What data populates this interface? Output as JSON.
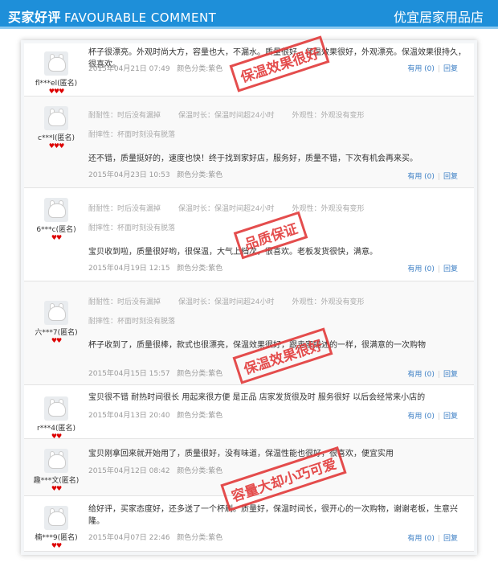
{
  "header": {
    "title_cn": "买家好评",
    "title_en": "FAVOURABLE COMMENT",
    "shop": "优宜居家用品店"
  },
  "ui": {
    "useful": "有用 (0)",
    "reply": "回复"
  },
  "stamps": [
    "保温效果很好",
    "品质保证",
    "保温效果很好",
    "容量大却小巧可爱"
  ],
  "reviews": [
    {
      "user": "fl***el(匿名)",
      "level": "♥♥♥",
      "text": "杯子很漂亮。外观时尚大方，容量也大，不漏水。质量很好，保温效果很好，外观漂亮。保温效果很持久，很喜欢。",
      "date": "2015年04月21日 07:49",
      "color": "颜色分类:紫色"
    },
    {
      "user": "c***l(匿名)",
      "level": "♥♥♥",
      "tags": [
        "耐耐性：时后没有漏掉",
        "保温时长：保温时间超24小时",
        "外观性：外观没有变形"
      ],
      "tag2": "耐摔性：杯面时刻没有脱落",
      "text": "还不错，质量挺好的，速度也快！终于找到家好店，服务好，质量不错，下次有机会再来买。",
      "date": "2015年04月23日 10:53",
      "color": "颜色分类:紫色"
    },
    {
      "user": "6***c(匿名)",
      "level": "♥♥",
      "tags": [
        "耐耐性：时后没有漏掉",
        "保温时长：保温时间超24小时",
        "外观性：外观没有变形"
      ],
      "tag2": "耐摔性：杯面时刻没有脱落",
      "text": "宝贝收到啦，质量很好哟，很保温，大气上档次，很喜欢。老板发货很快，满意。",
      "date": "2015年04月19日 12:15",
      "color": "颜色分类:紫色"
    },
    {
      "user": "六***7(匿名)",
      "level": "♥♥",
      "tags": [
        "耐耐性：时后没有漏掉",
        "保温时长：保温时间超24小时",
        "外观性：外观没有变形"
      ],
      "tag2": "耐摔性：杯面时刻没有脱落",
      "text": "杯子收到了，质量很棒，款式也很漂亮，保温效果很好，跟卖家描述的一样，很满意的一次购物",
      "date": "2015年04月15日 15:57",
      "color": "颜色分类:紫色"
    },
    {
      "user": "r***4(匿名)",
      "level": "♥♥",
      "text": "宝贝很不错 耐热时间很长 用起来很方便 是正品 店家发货很及时 服务很好 以后会经常来小店的",
      "date": "2015年04月13日 20:40",
      "color": "颜色分类:紫色"
    },
    {
      "user": "趣***文(匿名)",
      "level": "♥♥",
      "text": "宝贝刚拿回来就开始用了，质量很好，没有味道，保温性能也很好，很喜欢，便宜实用",
      "date": "2015年04月12日 08:42",
      "color": "颜色分类:紫色"
    },
    {
      "user": "楠***9(匿名)",
      "level": "♥♥",
      "text": "给好评，买家态度好，还多送了一个杯刷。质量好，保温时间长，很开心的一次购物，谢谢老板，生意兴隆。",
      "date": "2015年04月07日 22:46",
      "color": "颜色分类:紫色"
    }
  ]
}
